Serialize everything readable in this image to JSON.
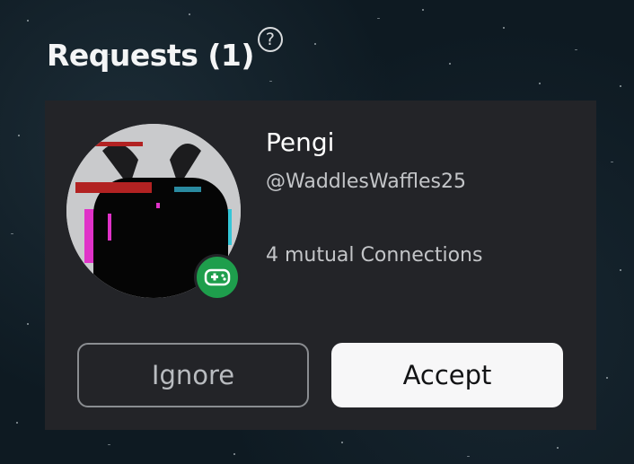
{
  "header": {
    "title": "Requests (1)",
    "help_icon": "question-circle-icon"
  },
  "request": {
    "display_name": "Pengi",
    "username": "@WaddlesWaffles25",
    "mutual": "4 mutual Connections",
    "status_icon": "gamepad-icon",
    "status_color": "#1e9e4c"
  },
  "actions": {
    "ignore_label": "Ignore",
    "accept_label": "Accept"
  },
  "colors": {
    "card_bg": "#232428",
    "accept_bg": "#f7f7f8",
    "background": "#0e1a22"
  }
}
